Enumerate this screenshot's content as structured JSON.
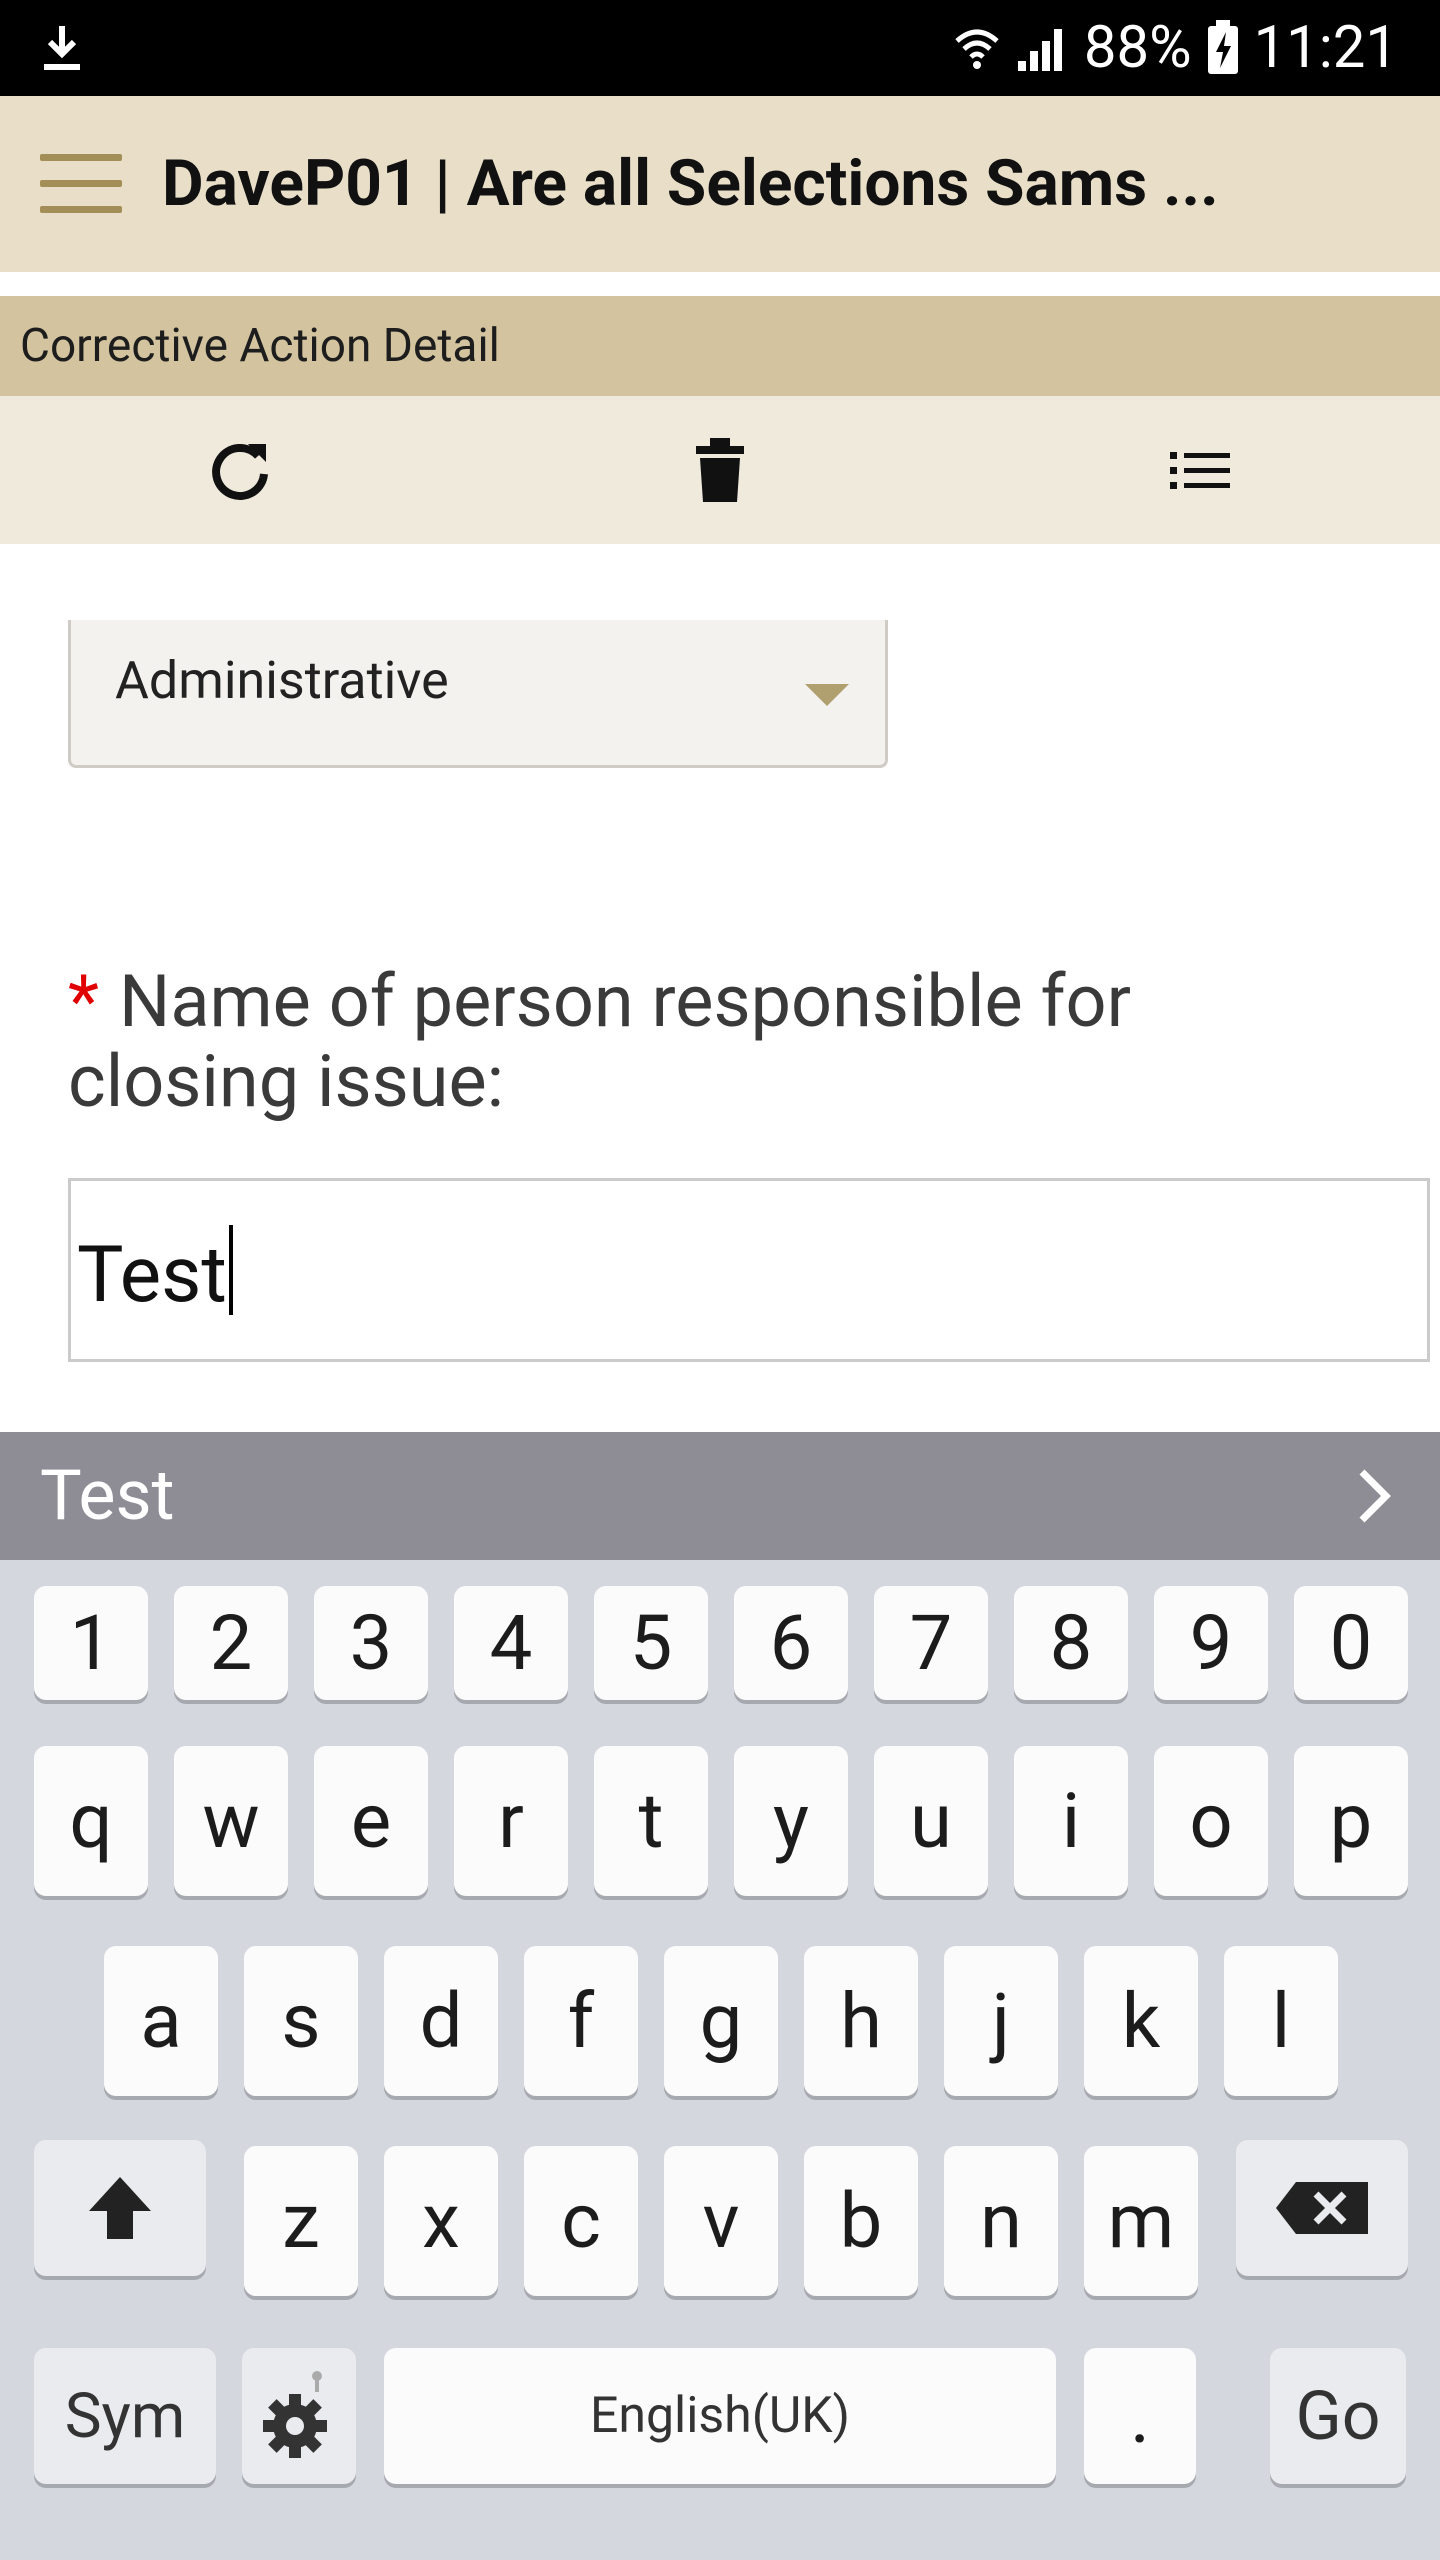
{
  "status_bar": {
    "battery": "88%",
    "time": "11:21"
  },
  "header": {
    "title": "DaveP01 | Are all Selections Sams ..."
  },
  "section": {
    "title": "Corrective Action Detail"
  },
  "toolbar": {
    "icons": [
      "refresh-icon",
      "trash-icon",
      "list-icon"
    ]
  },
  "form": {
    "select_value": "Administrative",
    "required_marker": "*",
    "field_label": "Name of person responsible for closing issue:",
    "field_value": "Test"
  },
  "suggestion_bar": {
    "suggestion": "Test"
  },
  "keyboard": {
    "row_numbers": [
      "1",
      "2",
      "3",
      "4",
      "5",
      "6",
      "7",
      "8",
      "9",
      "0"
    ],
    "row1": [
      "q",
      "w",
      "e",
      "r",
      "t",
      "y",
      "u",
      "i",
      "o",
      "p"
    ],
    "row2": [
      "a",
      "s",
      "d",
      "f",
      "g",
      "h",
      "j",
      "k",
      "l"
    ],
    "row3": [
      "z",
      "x",
      "c",
      "v",
      "b",
      "n",
      "m"
    ],
    "sym": "Sym",
    "space": "English(UK)",
    "period": ".",
    "go": "Go"
  }
}
